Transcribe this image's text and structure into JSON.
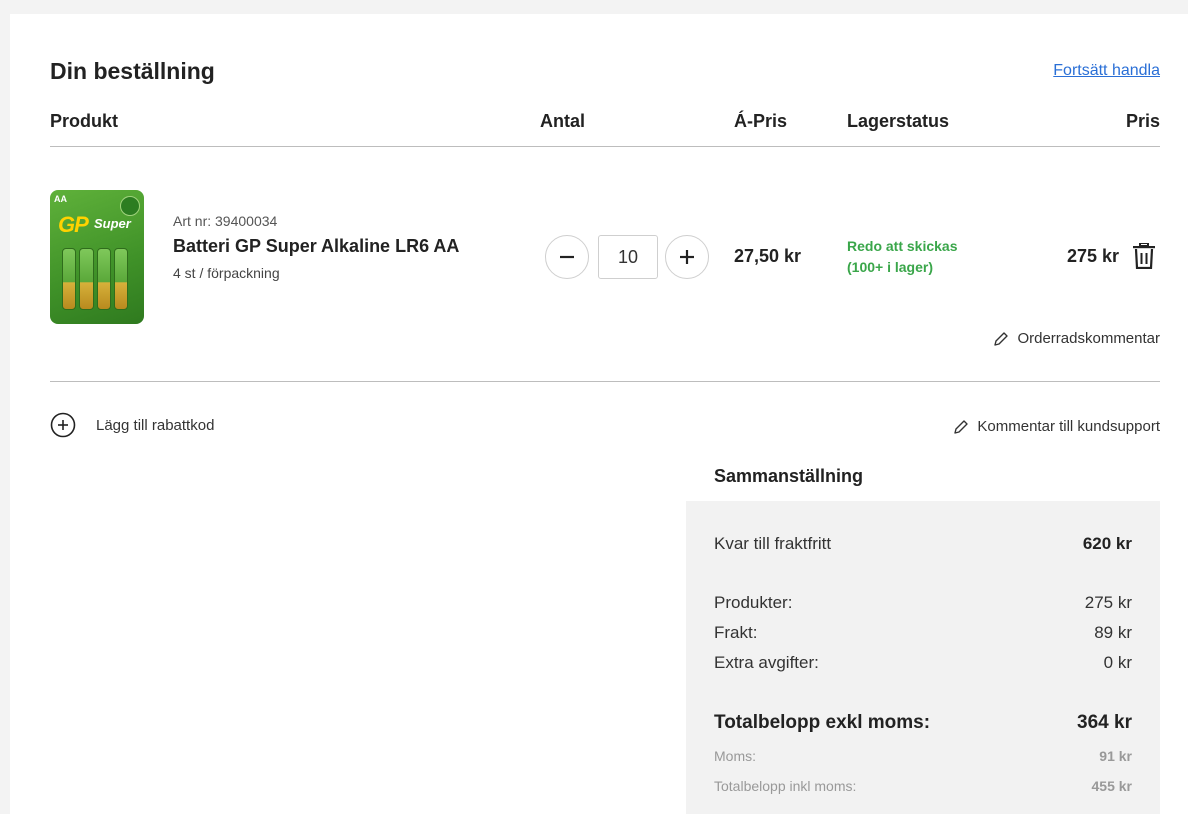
{
  "header": {
    "title": "Din beställning",
    "continue_link": "Fortsätt handla"
  },
  "columns": {
    "product": "Produkt",
    "quantity": "Antal",
    "unit_price": "Á-Pris",
    "stock": "Lagerstatus",
    "price": "Pris"
  },
  "item": {
    "image_brand": "GP",
    "image_brand_line": "Super",
    "image_size_tag": "AA",
    "art_nr": "Art nr: 39400034",
    "name": "Batteri GP Super Alkaline LR6 AA",
    "pack": "4 st / förpackning",
    "quantity": "10",
    "unit_price": "27,50 kr",
    "stock_line1": "Redo att skickas",
    "stock_line2": "(100+ i lager)",
    "line_price": "275 kr",
    "row_comment": "Orderradskommentar"
  },
  "actions": {
    "discount": "Lägg till rabattkod",
    "support_comment": "Kommentar till kundsupport"
  },
  "summary": {
    "title": "Sammanställning",
    "free_shipping_label": "Kvar till fraktfritt",
    "free_shipping_value": "620 kr",
    "products_label": "Produkter:",
    "products_value": "275 kr",
    "shipping_label": "Frakt:",
    "shipping_value": "89 kr",
    "extra_label": "Extra avgifter:",
    "extra_value": "0 kr",
    "total_excl_label": "Totalbelopp exkl moms:",
    "total_excl_value": "364 kr",
    "vat_label": "Moms:",
    "vat_value": "91 kr",
    "total_incl_label": "Totalbelopp inkl moms:",
    "total_incl_value": "455 kr"
  },
  "colors": {
    "link": "#2a6fd6",
    "stock_ok": "#3aa64a",
    "summary_bg": "#f2f2f2"
  }
}
